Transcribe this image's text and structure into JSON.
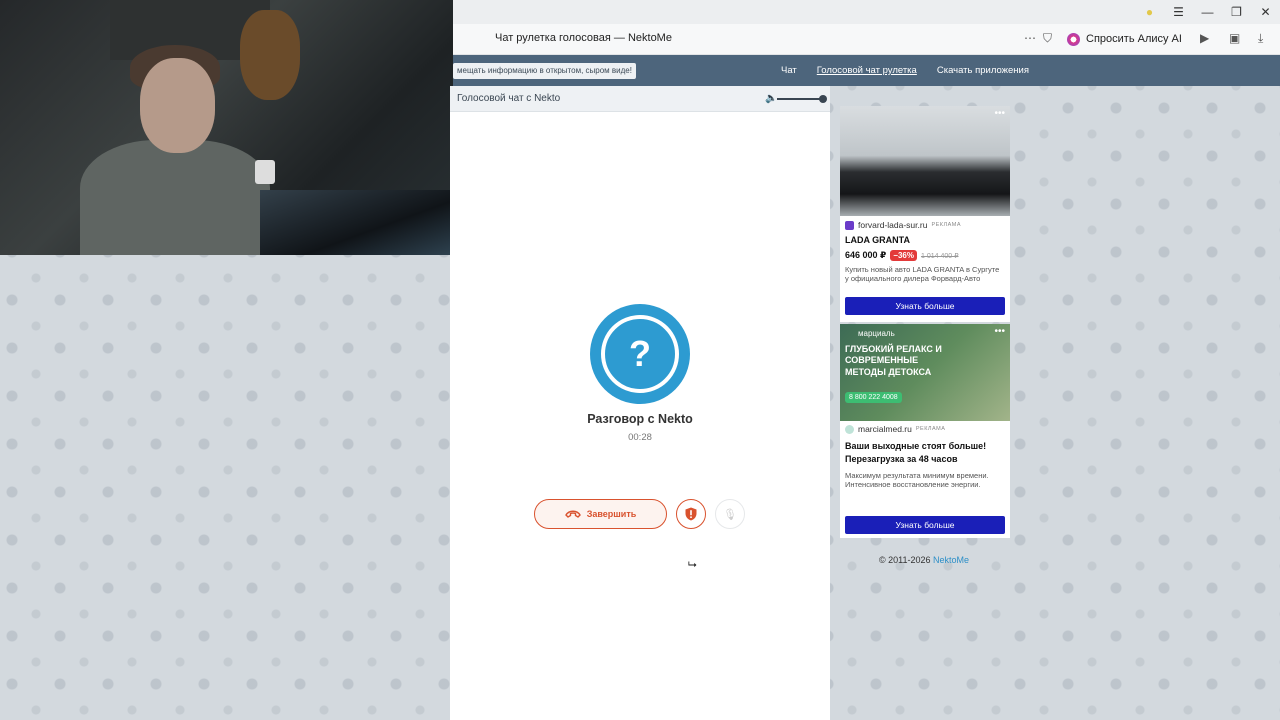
{
  "browser": {
    "tab_title": "Чат рулетка голосовая — NektoMe",
    "alice_label": "Спросить Алису AI",
    "icons": [
      "more-icon",
      "bookmark-icon",
      "media-icon",
      "collections-icon",
      "download-icon"
    ]
  },
  "nav": {
    "info_text": "мещать информацию в открытом, сыром виде!",
    "links": [
      "Чат",
      "Голосовой чат рулетка",
      "Скачать приложения"
    ]
  },
  "chat": {
    "header_title": "Голосовой чат с Nekto",
    "volume": 1.0,
    "avatar_symbol": "?",
    "call_title": "Разговор с Nekto",
    "timer": "00:28",
    "end_label": "Завершить"
  },
  "ads": [
    {
      "source": "forvard-lada-sur.ru",
      "tag": "РЕКЛАМА",
      "title": "LADA GRANTA",
      "price": "646 000 ₽",
      "discount": "−36%",
      "old_price": "1 014 400 ₽",
      "description": "Купить новый авто LADA GRANTA в Сургуте у официального дилера Форвард-Авто",
      "button": "Узнать больше"
    },
    {
      "logo": "марциаль",
      "headline": "ГЛУБОКИЙ РЕЛАКС И СОВРЕМЕННЫЕ МЕТОДЫ ДЕТОКСА",
      "phone": "8 800 222 4008",
      "source": "marcialmed.ru",
      "tag": "РЕКЛАМА",
      "title": "Ваши выходные стоят больше! Перезагрузка за 48 часов",
      "description": "Максимум результата минимум времени. Интенсивное восстановление энергии.",
      "button": "Узнать больше"
    }
  ],
  "footer": {
    "copyright": "© 2011-2026",
    "brand_link": "NektoMe"
  },
  "colors": {
    "nav_bg": "#4d657c",
    "avatar": "#2d9bd1",
    "end_call": "#d9522e",
    "ad_button": "#1a1fb8"
  }
}
